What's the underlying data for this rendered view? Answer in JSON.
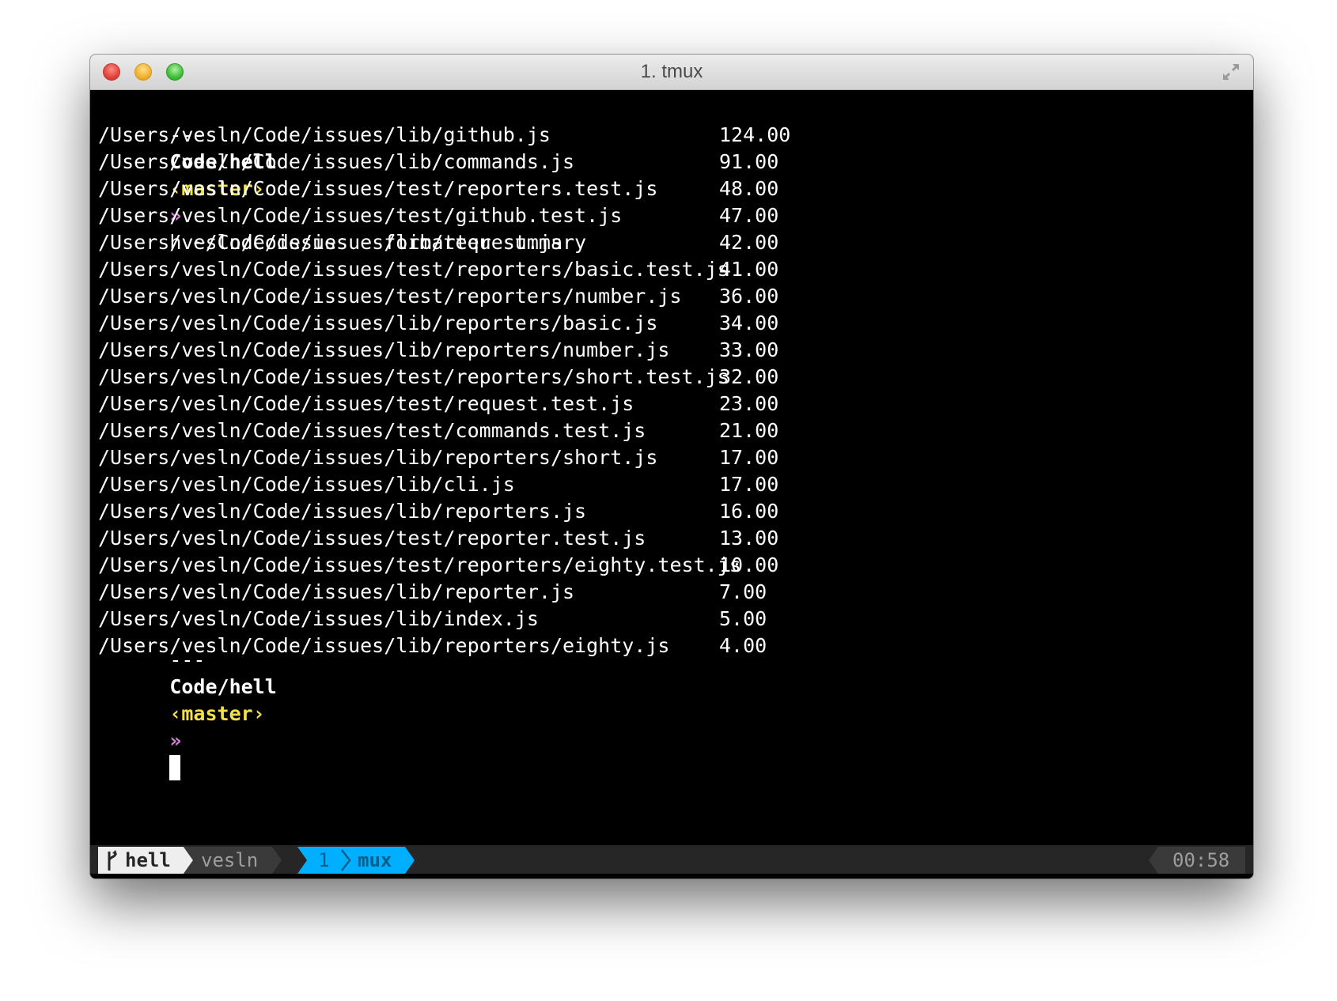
{
  "window": {
    "title": "1. tmux"
  },
  "terminal": {
    "prompt1": {
      "dashes": "---",
      "dir": "Code/hell",
      "branch": "‹master›",
      "arrow": "»",
      "command": "h ~/Code/issues --formatter summary"
    },
    "rows": [
      {
        "path": "/Users/vesln/Code/issues/lib/github.js",
        "value": "124.00"
      },
      {
        "path": "/Users/vesln/Code/issues/lib/commands.js",
        "value": "91.00"
      },
      {
        "path": "/Users/vesln/Code/issues/test/reporters.test.js",
        "value": "48.00"
      },
      {
        "path": "/Users/vesln/Code/issues/test/github.test.js",
        "value": "47.00"
      },
      {
        "path": "/Users/vesln/Code/issues/lib/request.js",
        "value": "42.00"
      },
      {
        "path": "/Users/vesln/Code/issues/test/reporters/basic.test.js",
        "value": "41.00"
      },
      {
        "path": "/Users/vesln/Code/issues/test/reporters/number.js",
        "value": "36.00"
      },
      {
        "path": "/Users/vesln/Code/issues/lib/reporters/basic.js",
        "value": "34.00"
      },
      {
        "path": "/Users/vesln/Code/issues/lib/reporters/number.js",
        "value": "33.00"
      },
      {
        "path": "/Users/vesln/Code/issues/test/reporters/short.test.js",
        "value": "32.00"
      },
      {
        "path": "/Users/vesln/Code/issues/test/request.test.js",
        "value": "23.00"
      },
      {
        "path": "/Users/vesln/Code/issues/test/commands.test.js",
        "value": "21.00"
      },
      {
        "path": "/Users/vesln/Code/issues/lib/reporters/short.js",
        "value": "17.00"
      },
      {
        "path": "/Users/vesln/Code/issues/lib/cli.js",
        "value": "17.00"
      },
      {
        "path": "/Users/vesln/Code/issues/lib/reporters.js",
        "value": "16.00"
      },
      {
        "path": "/Users/vesln/Code/issues/test/reporter.test.js",
        "value": "13.00"
      },
      {
        "path": "/Users/vesln/Code/issues/test/reporters/eighty.test.js",
        "value": "10.00"
      },
      {
        "path": "/Users/vesln/Code/issues/lib/reporter.js",
        "value": "7.00"
      },
      {
        "path": "/Users/vesln/Code/issues/lib/index.js",
        "value": "5.00"
      },
      {
        "path": "/Users/vesln/Code/issues/lib/reporters/eighty.js",
        "value": "4.00"
      }
    ],
    "prompt2": {
      "dashes": "---",
      "dir": "Code/hell",
      "branch": "‹master›",
      "arrow": "»"
    }
  },
  "statusbar": {
    "session": "hell",
    "user": "vesln",
    "window_index": "1",
    "window_name": "mux",
    "clock": "00:58",
    "colors": {
      "session_bg": "#eeeeee",
      "session_fg": "#262626",
      "user_bg": "#3a3a3a",
      "user_fg": "#9e9e9e",
      "window_bg": "#00afff",
      "window_fg": "#005f87",
      "clock_bg": "#3a3a3a",
      "clock_fg": "#9e9e9e"
    }
  }
}
